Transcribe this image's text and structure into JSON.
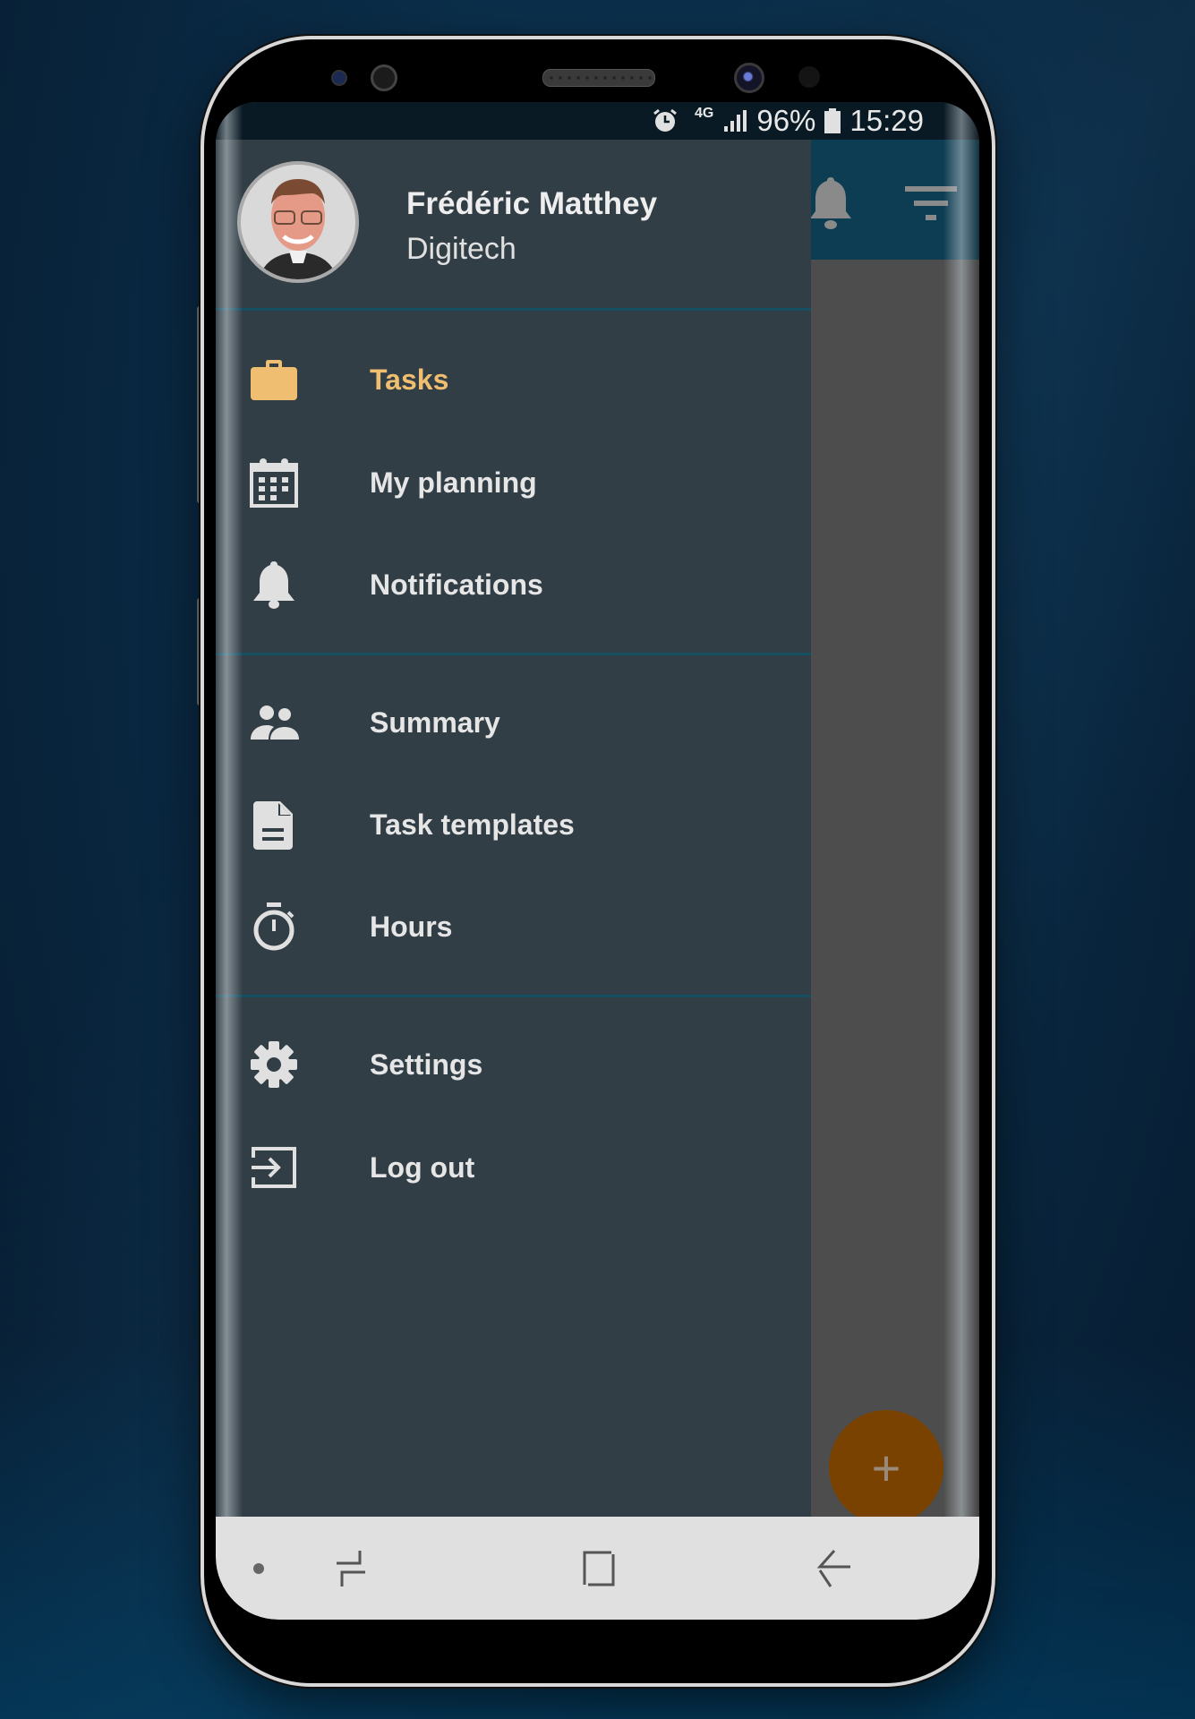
{
  "status_bar": {
    "alarm_icon": "alarm-clock-icon",
    "network": "4G",
    "signal_icon": "signal-bars-icon",
    "battery_percent": "96%",
    "battery_icon": "battery-icon",
    "time": "15:29"
  },
  "background_app": {
    "header_icons": [
      "bell-icon",
      "filter-icon"
    ],
    "fab_label": "+",
    "header_color": "#0d3d52"
  },
  "drawer": {
    "user": {
      "name": "Frédéric Matthey",
      "organization": "Digitech",
      "avatar": "user-photo"
    },
    "sections": [
      {
        "items": [
          {
            "label": "Tasks",
            "icon": "briefcase-icon",
            "active": true
          },
          {
            "label": "My planning",
            "icon": "calendar-icon",
            "active": false
          },
          {
            "label": "Notifications",
            "icon": "bell-icon",
            "active": false
          }
        ]
      },
      {
        "items": [
          {
            "label": "Summary",
            "icon": "people-icon",
            "active": false
          },
          {
            "label": "Task templates",
            "icon": "document-icon",
            "active": false
          },
          {
            "label": "Hours",
            "icon": "stopwatch-icon",
            "active": false
          }
        ]
      },
      {
        "items": [
          {
            "label": "Settings",
            "icon": "gear-icon",
            "active": false
          },
          {
            "label": "Log out",
            "icon": "logout-icon",
            "active": false
          }
        ]
      }
    ],
    "colors": {
      "background": "#323e46",
      "active_text": "#efbe70",
      "text": "#e6e6e6",
      "divider": "#164f62"
    }
  },
  "nav_bar": {
    "buttons": [
      "recent-apps",
      "home",
      "back"
    ]
  }
}
